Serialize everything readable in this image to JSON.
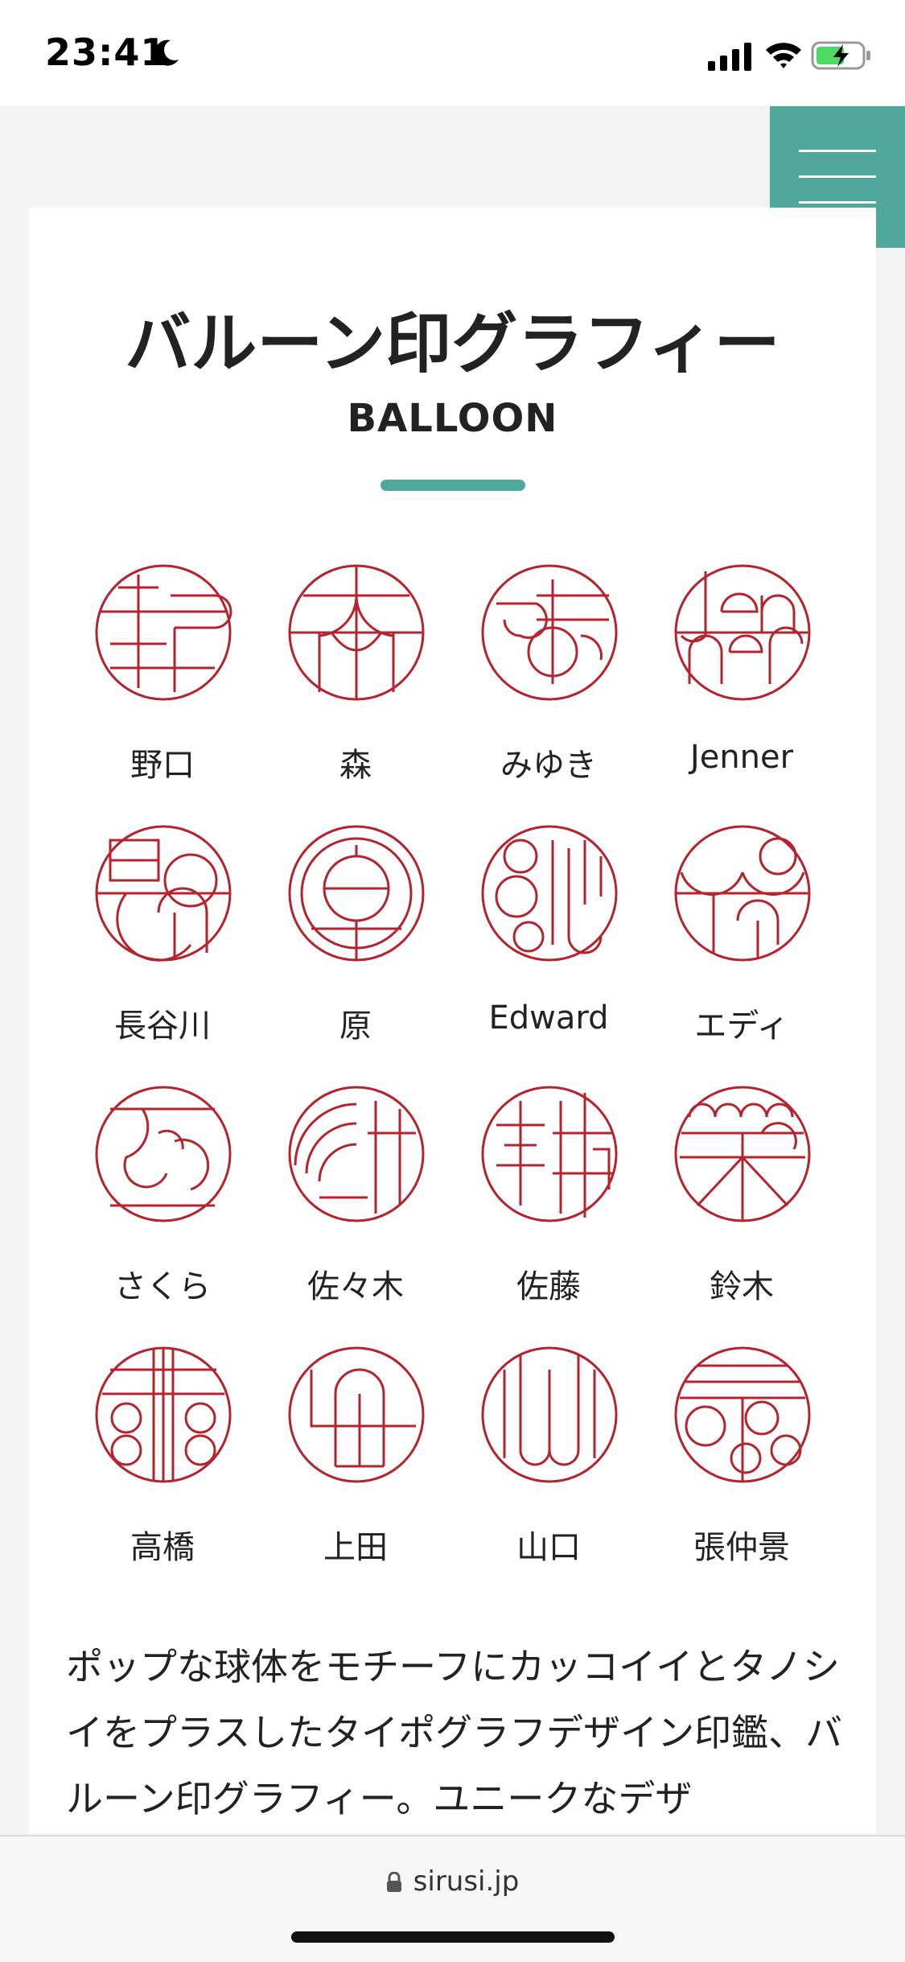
{
  "status_bar": {
    "time": "23:41"
  },
  "header": {
    "title": "バルーン印グラフィー",
    "subtitle": "BALLOON"
  },
  "seals": [
    {
      "label": "野口"
    },
    {
      "label": "森"
    },
    {
      "label": "みゆき"
    },
    {
      "label": "Jenner"
    },
    {
      "label": "長谷川"
    },
    {
      "label": "原"
    },
    {
      "label": "Edward"
    },
    {
      "label": "エディ"
    },
    {
      "label": "さくら"
    },
    {
      "label": "佐々木"
    },
    {
      "label": "佐藤"
    },
    {
      "label": "鈴木"
    },
    {
      "label": "高橋"
    },
    {
      "label": "上田"
    },
    {
      "label": "山口"
    },
    {
      "label": "張仲景"
    }
  ],
  "description": "ポップな球体をモチーフにカッコイイとタノシイをプラスしたタイポグラフデザイン印鑑、バルーン印グラフィー。ユニークなデザ",
  "browser": {
    "url": "sirusi.jp"
  },
  "colors": {
    "accent": "#4fa89b",
    "seal_red": "#b5242c"
  }
}
